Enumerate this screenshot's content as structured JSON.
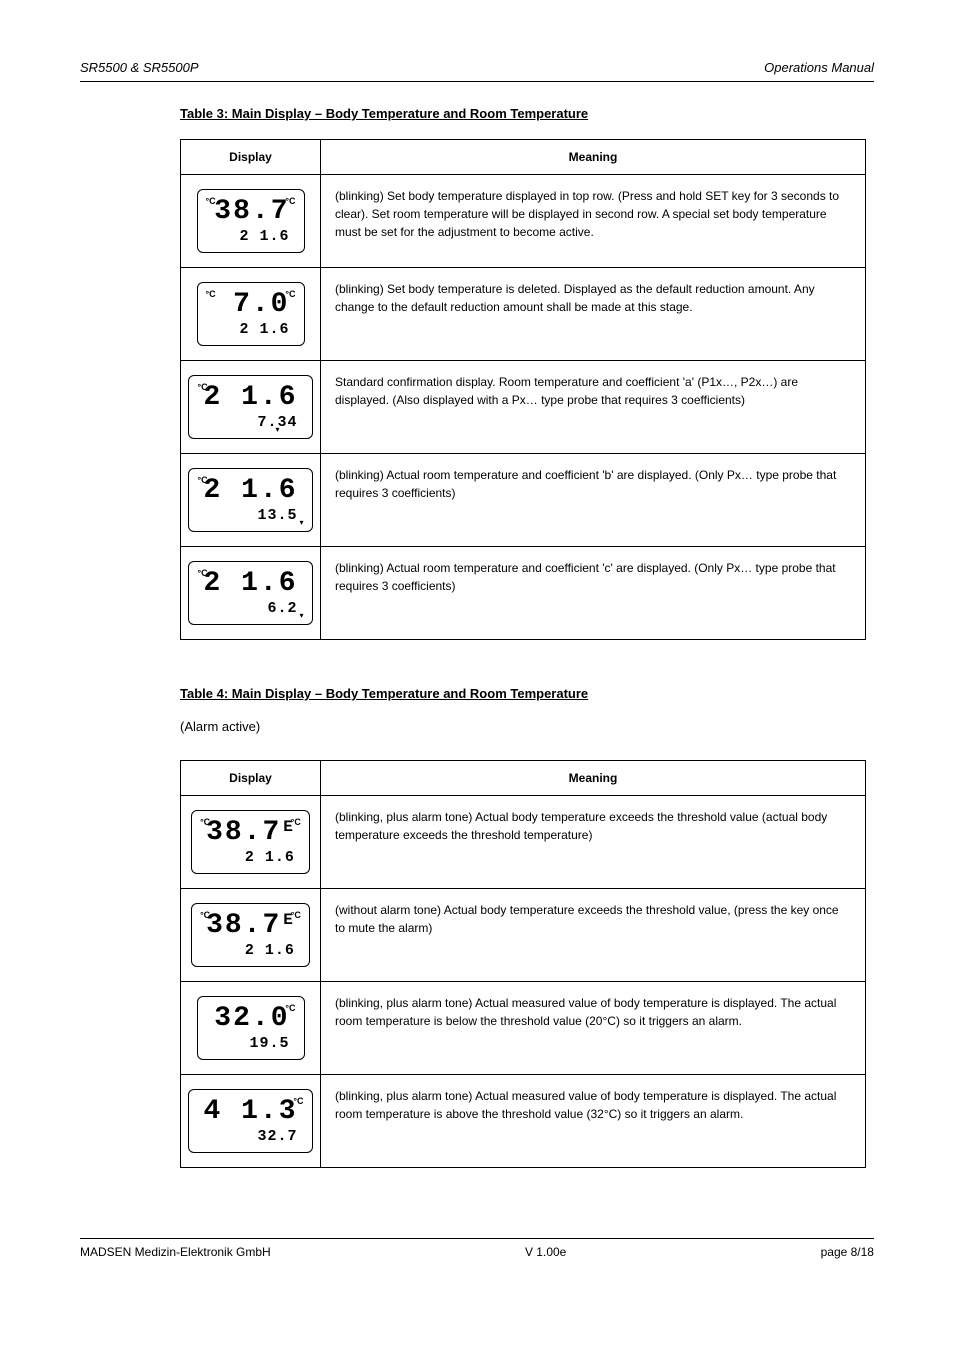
{
  "header": {
    "doc_id": "SR5500 & SR5500P",
    "doc_title": "Operations Manual"
  },
  "tables": {
    "t1": {
      "heading": "Table 3: Main Display – Body Temperature and Room Temperature",
      "col_display": "Display",
      "col_meaning": "Meaning",
      "rows": [
        {
          "lcd_big": "38.7",
          "lcd_small": "2 1.6",
          "lcd_sup_left": "°C",
          "lcd_sup_right": "°C",
          "meaning": "(blinking)\nSet body temperature displayed in top row. (Press and hold SET key for 3 seconds to clear). Set room temperature will be displayed in second row. A special set body temperature must be set for the adjustment to become active."
        },
        {
          "lcd_big": "7.0",
          "lcd_small": "2 1.6",
          "lcd_sup_left": "°C",
          "lcd_sup_right": "°C",
          "meaning": "(blinking)\nSet body temperature is deleted. Displayed as the default reduction amount. Any change to the default reduction amount shall be made at this stage."
        },
        {
          "lcd_big": "2 1.6",
          "lcd_small": "7.34",
          "lcd_sup_left": "°C",
          "lcd_marker_mid": "▾",
          "meaning": "Standard confirmation display. Room temperature and coefficient 'a' (P1x…, P2x…) are displayed. (Also displayed with a Px… type probe that requires 3 coefficients)"
        },
        {
          "lcd_big": "2 1.6",
          "lcd_small": "13.5",
          "lcd_sup_left": "°C",
          "lcd_marker_right": "▾",
          "meaning": "(blinking)\nActual room temperature and coefficient 'b' are displayed. (Only Px… type probe that requires 3 coefficients)"
        },
        {
          "lcd_big": "2 1.6",
          "lcd_small": "6.2",
          "lcd_sup_left": "°C",
          "lcd_marker_right": "▾",
          "meaning": "(blinking)\nActual room temperature and coefficient 'c' are displayed. (Only Px… type probe that requires 3 coefficients)"
        }
      ]
    },
    "t2": {
      "heading": "Table 4: Main Display – Body Temperature and Room Temperature",
      "paren": "(Alarm active)",
      "col_display": "Display",
      "col_meaning": "Meaning",
      "rows": [
        {
          "lcd_big": "38.7",
          "lcd_small": "2 1.6",
          "lcd_sup_left": "°C",
          "lcd_sup_right": "°C",
          "lcd_top_right_extra": "E",
          "meaning": "(blinking, plus alarm tone)\nActual body temperature exceeds the threshold value (actual body temperature exceeds the threshold temperature)"
        },
        {
          "lcd_big": "38.7",
          "lcd_small": "2 1.6",
          "lcd_sup_left": "°C",
          "lcd_sup_right": "°C",
          "lcd_top_right_extra": "E",
          "meaning": "(without alarm tone)\nActual body temperature exceeds the threshold value, (press the key once to mute the alarm)"
        },
        {
          "lcd_big": "32.0",
          "lcd_small": "19.5",
          "lcd_sup_right": "°C",
          "meaning": "(blinking, plus alarm tone)\nActual measured value of body temperature is displayed. The actual room temperature is below the threshold value (20°C) so it triggers an alarm."
        },
        {
          "lcd_big": "4 1.3",
          "lcd_small": "32.7",
          "lcd_sup_right": "°C",
          "meaning": "(blinking, plus alarm tone)\nActual measured value of body temperature is displayed. The actual room temperature is above the threshold value (32°C) so it triggers an alarm."
        }
      ]
    }
  },
  "footer": {
    "company": "MADSEN Medizin-Elektronik GmbH",
    "version": "V 1.00e",
    "page": "page 8/18"
  }
}
